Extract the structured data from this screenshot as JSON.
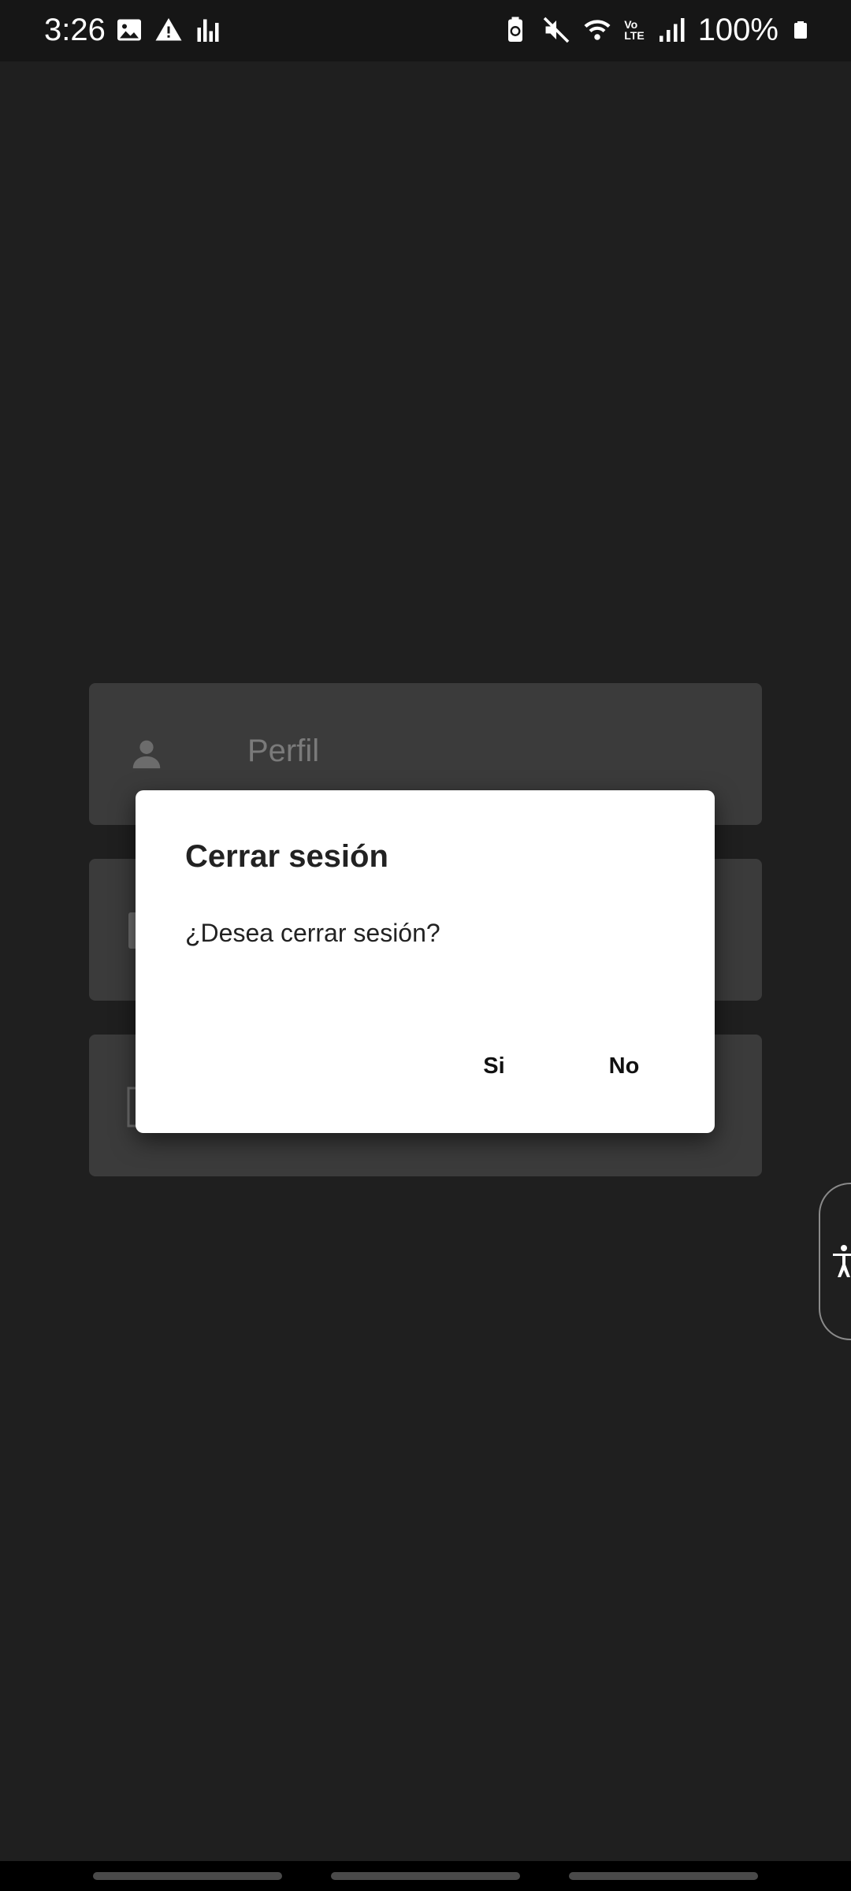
{
  "status_bar": {
    "time": "3:26",
    "battery_percent": "100%",
    "left_icons": [
      "image-icon",
      "warning-icon",
      "stats-icon"
    ],
    "right_icons": [
      "battery-saver-icon",
      "mute-icon",
      "wifi-icon",
      "volte-icon",
      "signal-icon",
      "battery-icon"
    ],
    "volte_label_top": "Vo",
    "volte_label_bottom": "LTE"
  },
  "background_menu": {
    "items": [
      {
        "label": "Perfil",
        "icon": "person-icon"
      },
      {
        "label": "",
        "icon": "item-icon"
      },
      {
        "label": "",
        "icon": "logout-icon"
      }
    ]
  },
  "dialog": {
    "title": "Cerrar sesión",
    "message": "¿Desea cerrar sesión?",
    "confirm_label": "Si",
    "cancel_label": "No"
  },
  "accessibility": {
    "icon": "accessibility-icon"
  },
  "colors": {
    "background": "#1f1f1f",
    "card": "#3b3b3b",
    "dialog": "#ffffff",
    "status_bar": "#161616"
  }
}
